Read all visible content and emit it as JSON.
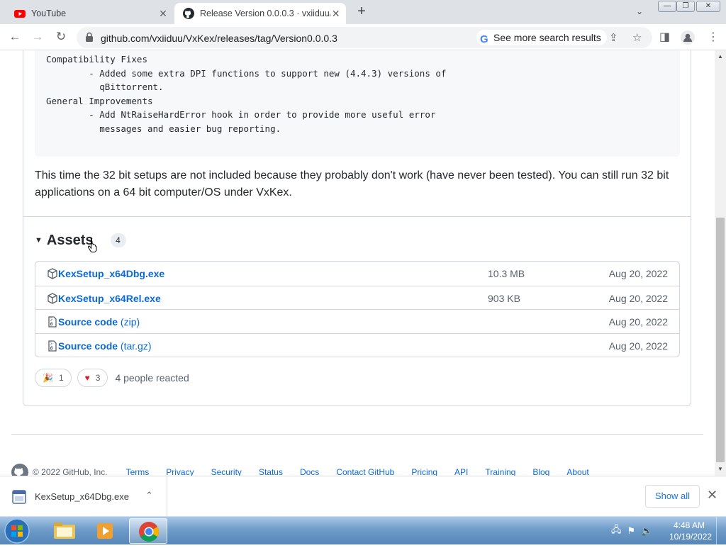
{
  "browser": {
    "tabs": [
      {
        "title": "YouTube",
        "icon": "youtube-icon",
        "active": false
      },
      {
        "title": "Release Version 0.0.0.3 · vxiiduu/VxKex",
        "icon": "github-icon",
        "active": true
      }
    ],
    "url": "github.com/vxiiduu/VxKex/releases/tag/Version0.0.0.3",
    "see_more": "See more search results"
  },
  "release": {
    "code_text": "Compatibility Fixes\n        - Added some extra DPI functions to support new (4.4.3) versions of\n          qBittorrent.\nGeneral Improvements\n        - Add NtRaiseHardError hook in order to provide more useful error\n          messages and easier bug reporting.",
    "note": "This time the 32 bit setups are not included because they probably don't work (have never been tested). You can still run 32 bit applications on a 64 bit computer/OS under VxKex.",
    "assets_title": "Assets",
    "assets_count": "4",
    "assets": [
      {
        "name": "KexSetup_x64Dbg.exe",
        "ext": "",
        "size": "10.3 MB",
        "date": "Aug 20, 2022",
        "icon": "package-icon"
      },
      {
        "name": "KexSetup_x64Rel.exe",
        "ext": "",
        "size": "903 KB",
        "date": "Aug 20, 2022",
        "icon": "package-icon"
      },
      {
        "name": "Source code",
        "ext": "(zip)",
        "size": "",
        "date": "Aug 20, 2022",
        "icon": "file-zip-icon"
      },
      {
        "name": "Source code",
        "ext": "(tar.gz)",
        "size": "",
        "date": "Aug 20, 2022",
        "icon": "file-zip-icon"
      }
    ],
    "reactions": [
      {
        "emoji": "🎉",
        "count": "1"
      },
      {
        "emoji": "♥",
        "count": "3"
      }
    ],
    "reactions_text": "4 people reacted"
  },
  "footer": {
    "copyright": "© 2022 GitHub, Inc.",
    "links": [
      "Terms",
      "Privacy",
      "Security",
      "Status",
      "Docs",
      "Contact GitHub",
      "Pricing",
      "API",
      "Training",
      "Blog",
      "About"
    ]
  },
  "download_bar": {
    "file": "KexSetup_x64Dbg.exe",
    "show_all": "Show all"
  },
  "taskbar": {
    "time": "4:48 AM",
    "date": "10/19/2022"
  },
  "colors": {
    "link": "#0969da",
    "chrome_tabstrip": "#dee1e6"
  }
}
